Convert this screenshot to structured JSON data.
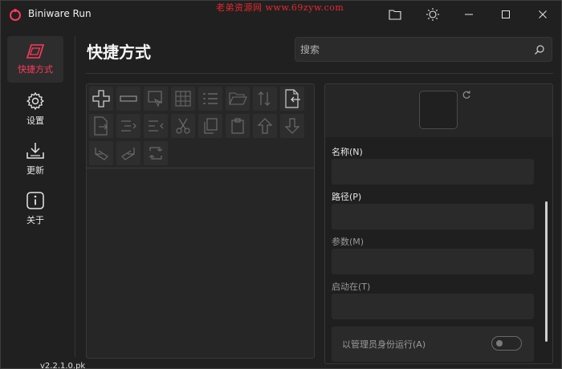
{
  "window": {
    "title": "Biniware Run",
    "watermark": "老弟资源网 www.69zyw.com",
    "controls": [
      "folder-icon",
      "theme-icon",
      "minimize-icon",
      "maximize-icon",
      "close-icon"
    ]
  },
  "nav": {
    "items": [
      {
        "label": "快捷方式",
        "icon": "shortcut-icon",
        "active": true
      },
      {
        "label": "设置",
        "icon": "gear-icon",
        "active": false
      },
      {
        "label": "更新",
        "icon": "download-icon",
        "active": false
      },
      {
        "label": "关于",
        "icon": "info-icon",
        "active": false
      }
    ]
  },
  "header": {
    "title": "快捷方式",
    "search_placeholder": "搜索"
  },
  "toolbar": {
    "tools": [
      "add-icon",
      "remove-icon",
      "screenshot-icon",
      "grid-icon",
      "list-icon",
      "open-folder-icon",
      "sort-icon",
      "import-icon",
      "export-icon",
      "indent-icon",
      "outdent-icon",
      "cut-icon",
      "copy-icon",
      "paste-icon",
      "move-up-icon",
      "move-down-icon",
      "undo-icon",
      "redo-icon",
      "refresh-icon"
    ]
  },
  "form": {
    "name_label": "名称(N)",
    "path_label": "路径(P)",
    "args_label": "参数(M)",
    "startin_label": "启动在(T)",
    "admin_label": "以管理员身份运行(A)",
    "admin_enabled": false
  },
  "background": {
    "taskbar_text": "v2.2.1.0.pk"
  },
  "colors": {
    "accent": "#ff3a5c",
    "window_bg": "#202020",
    "panel_bg": "#262626"
  }
}
